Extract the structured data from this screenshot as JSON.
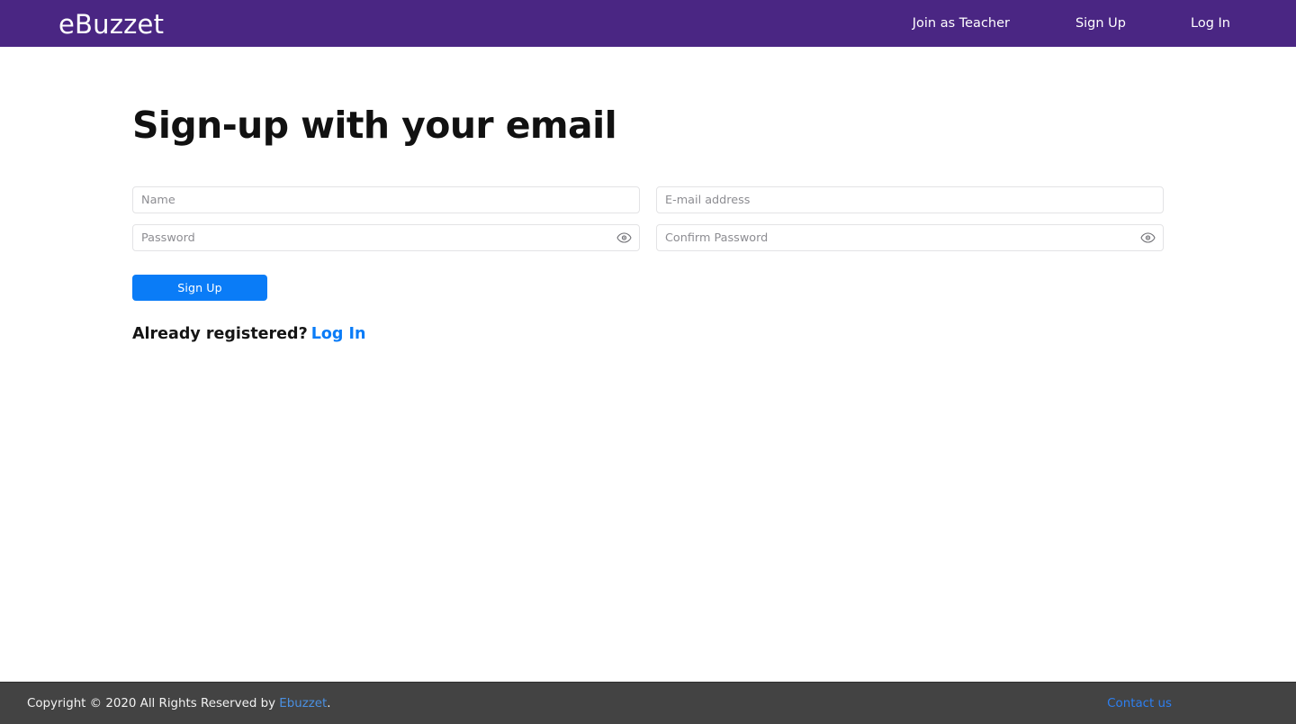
{
  "colors": {
    "navbar_bg": "#4a2683",
    "accent_blue": "#0a7cf7",
    "footer_bg": "#434343",
    "footer_link": "#4a90e2",
    "input_border": "#e3e3e5",
    "placeholder": "#8d8d92",
    "page_bg": "#ffffff",
    "heading": "#111111"
  },
  "navbar": {
    "brand": "eBuzzet",
    "links": [
      {
        "label": "Join as Teacher",
        "name": "nav-link-join-as-teacher"
      },
      {
        "label": "Sign Up",
        "name": "nav-link-sign-up"
      },
      {
        "label": "Log In",
        "name": "nav-link-log-in"
      }
    ]
  },
  "main": {
    "title": "Sign-up with your email",
    "form": {
      "fields": [
        {
          "name": "name-input",
          "placeholder": "Name",
          "value": "",
          "type": "text",
          "eye": false
        },
        {
          "name": "email-input",
          "placeholder": "E-mail address",
          "value": "",
          "type": "text",
          "eye": false
        },
        {
          "name": "password-input",
          "placeholder": "Password",
          "value": "",
          "type": "password",
          "eye": true,
          "eye_icon": "eye-icon"
        },
        {
          "name": "confirm-password-input",
          "placeholder": "Confirm Password",
          "value": "",
          "type": "password",
          "eye": true,
          "eye_icon": "eye-icon"
        }
      ],
      "submit_label": "Sign Up"
    },
    "already_registered": {
      "text": "Already registered?",
      "link_label": "Log In"
    }
  },
  "footer": {
    "copyright_prefix": "Copyright © 2020 All Rights Reserved by ",
    "copyright_link": "Ebuzzet",
    "copyright_suffix": ".",
    "contact_label": "Contact us"
  }
}
